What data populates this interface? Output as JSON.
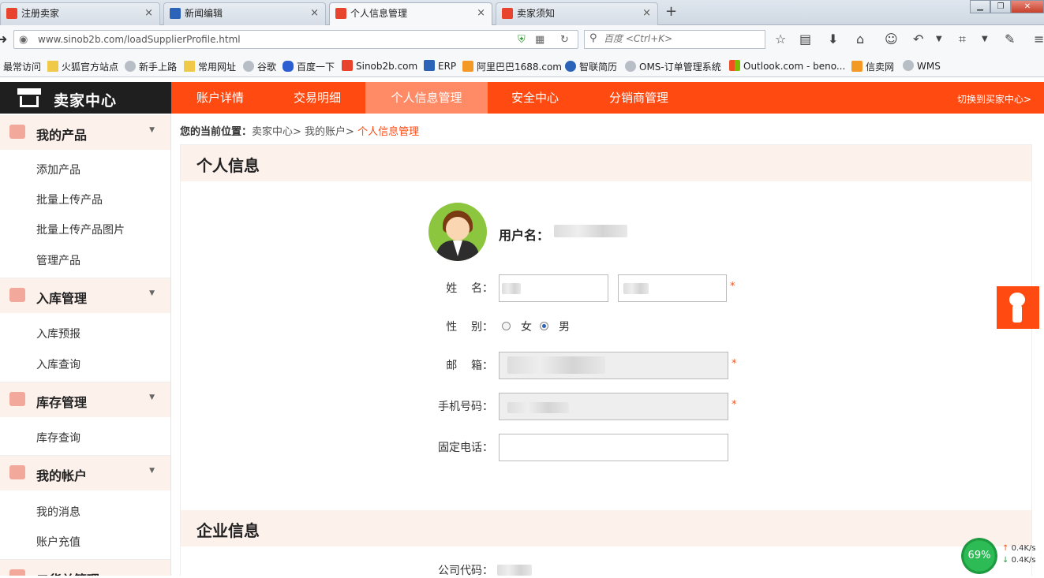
{
  "browser": {
    "tabs": [
      {
        "label": "注册卖家",
        "close": "×"
      },
      {
        "label": "新闻编辑",
        "close": "×"
      },
      {
        "label": "个人信息管理",
        "close": "×"
      },
      {
        "label": "卖家须知",
        "close": "×"
      }
    ],
    "new_tab": "+",
    "window_buttons": {
      "minimize": "▁",
      "restore": "❐",
      "close": "✕"
    },
    "url": "www.sinob2b.com/loadSupplierProfile.html",
    "search_placeholder": "百度 <Ctrl+K>",
    "bookmarks": [
      {
        "label": "最常访问",
        "icon": "none"
      },
      {
        "label": "火狐官方站点",
        "icon": "folder-icon"
      },
      {
        "label": "新手上路",
        "icon": "globe-icon"
      },
      {
        "label": "常用网址",
        "icon": "folder-icon"
      },
      {
        "label": "谷歌",
        "icon": "globe-icon"
      },
      {
        "label": "百度一下",
        "icon": "paw-icon"
      },
      {
        "label": "Sinob2b.com",
        "icon": "sinob2b-icon"
      },
      {
        "label": "ERP",
        "icon": "stack-icon"
      },
      {
        "label": "阿里巴巴1688.com",
        "icon": "alibaba-icon"
      },
      {
        "label": "智联简历",
        "icon": "zhilian-icon"
      },
      {
        "label": "OMS-订单管理系统",
        "icon": "globe-icon"
      },
      {
        "label": "Outlook.com - beno...",
        "icon": "microsoft-icon"
      },
      {
        "label": "信卖网",
        "icon": "xinmai-icon"
      },
      {
        "label": "WMS",
        "icon": "globe-icon"
      }
    ]
  },
  "header": {
    "brand": "卖家中心",
    "menu": [
      "账户详情",
      "交易明细",
      "个人信息管理",
      "安全中心",
      "分销商管理"
    ],
    "active_menu": "个人信息管理",
    "switch_link": "切换到买家中心>"
  },
  "sidebar": {
    "groups": [
      {
        "label": "我的产品",
        "icon": "box-icon",
        "items": [
          "添加产品",
          "批量上传产品",
          "批量上传产品图片",
          "管理产品"
        ]
      },
      {
        "label": "入库管理",
        "icon": "inbox-icon",
        "items": [
          "入库预报",
          "入库查询"
        ]
      },
      {
        "label": "库存管理",
        "icon": "boxes-icon",
        "items": [
          "库存查询"
        ]
      },
      {
        "label": "我的帐户",
        "icon": "lock-icon",
        "items": [
          "我的消息",
          "账户充值"
        ]
      },
      {
        "label": "二货单管理",
        "icon": "box-icon",
        "items": []
      }
    ]
  },
  "breadcrumb": {
    "prefix": "您的当前位置：",
    "path": "卖家中心> 我的账户> ",
    "current": "个人信息管理"
  },
  "profile": {
    "section_title": "个人信息",
    "username_label": "用户名：",
    "fields": {
      "name_label": "姓    名：",
      "gender_label": "性    别：",
      "gender_female": "女",
      "gender_male": "男",
      "gender_selected": "男",
      "email_label": "邮    箱：",
      "mobile_label": "手机号码：",
      "phone_label": "固定电话："
    },
    "required_mark": "*"
  },
  "company": {
    "section_title": "企业信息",
    "code_label": "公司代码："
  },
  "speed_widget": {
    "percent": "69%",
    "upload": "0.4K/s",
    "download": "0.4K/s"
  },
  "colors": {
    "brand_orange": "#ff4a12",
    "active_menu": "#ff8a66",
    "section_bg": "#fdf1ec"
  }
}
